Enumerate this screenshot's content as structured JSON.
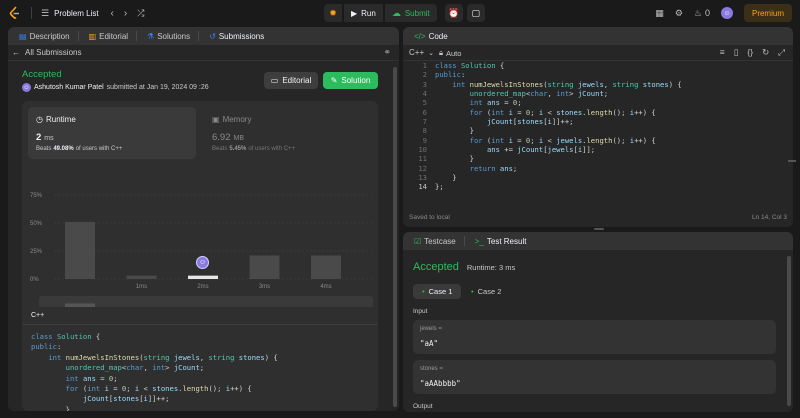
{
  "topbar": {
    "problem_list": "Problem List",
    "run": "Run",
    "submit": "Submit",
    "streak": "0",
    "premium": "Premium"
  },
  "left": {
    "tabs": [
      "Description",
      "Editorial",
      "Solutions",
      "Submissions"
    ],
    "back_label": "All Submissions",
    "status": "Accepted",
    "author": "Ashutosh Kumar Patel",
    "submitted": "submitted at Jan 19, 2024 09 :26",
    "editorial_btn": "Editorial",
    "solution_btn": "Solution",
    "runtime": {
      "label": "Runtime",
      "value": "2",
      "unit": "ms",
      "beats_pre": "Beats",
      "beats_pct": "49.08%",
      "beats_post": "of users with C++"
    },
    "memory": {
      "label": "Memory",
      "value": "6.92",
      "unit": "MB",
      "beats_pre": "Beats",
      "beats_pct": "5.45%",
      "beats_post": "of users with C++"
    },
    "lang": "C++"
  },
  "chart_data": {
    "type": "bar",
    "categories": [
      "",
      "1ms",
      "2ms",
      "3ms",
      "4ms"
    ],
    "values": [
      51,
      3,
      3,
      21,
      21
    ],
    "highlight_index": 2,
    "y_ticks": [
      "75%",
      "50%",
      "25%",
      "0%"
    ],
    "ylim": [
      0,
      75
    ],
    "grid": true
  },
  "code_lines": [
    "class Solution {",
    "public:",
    "    int numJewelsInStones(string jewels, string stones) {",
    "        unordered_map<char, int> jCount;",
    "        int ans = 0;",
    "        for (int i = 0; i < stones.length(); i++) {",
    "            jCount[stones[i]]++;",
    "        }",
    "        for (int i = 0; i < jewels.length(); i++) {",
    "            ans += jCount[jewels[i]];",
    "        }",
    "        return ans;",
    "    }",
    "};"
  ],
  "code_panel": {
    "title": "Code",
    "lang": "C++",
    "auto": "Auto",
    "saved": "Saved to local",
    "cursor": "Ln 14, Col 3"
  },
  "test_panel": {
    "tab_testcase": "Testcase",
    "tab_result": "Test Result",
    "status": "Accepted",
    "runtime": "Runtime: 3 ms",
    "case1": "Case 1",
    "case2": "Case 2",
    "input_label": "Input",
    "var1_name": "jewels =",
    "var1_value": "\"aA\"",
    "var2_name": "stones =",
    "var2_value": "\"aAAbbbb\"",
    "output_label": "Output"
  },
  "colors": {
    "accent_green": "#2cbb5d",
    "orange": "#ffa116",
    "keyword": "#569cd6",
    "type": "#4ec9b0",
    "func": "#dcdcaa"
  }
}
